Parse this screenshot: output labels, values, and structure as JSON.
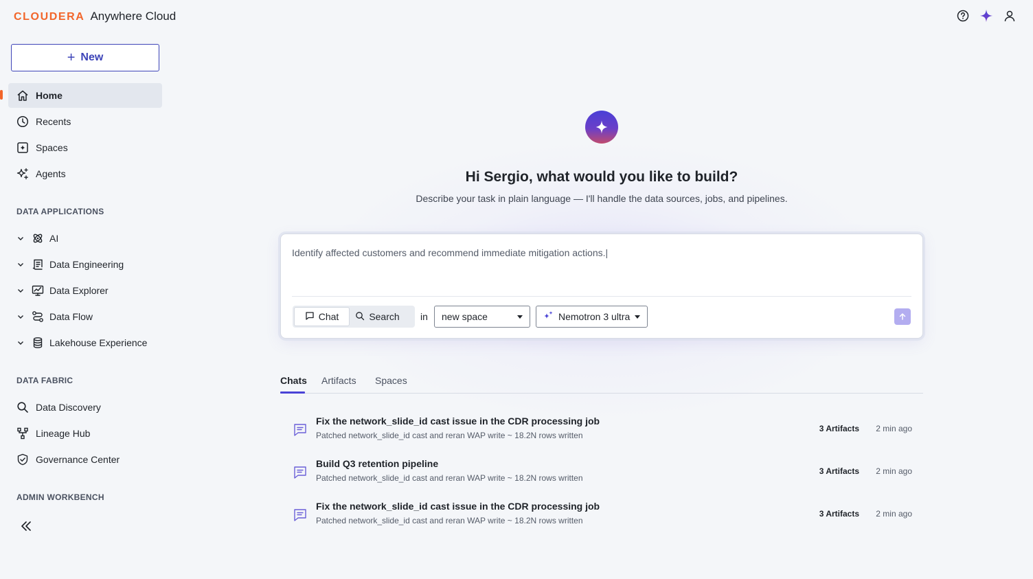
{
  "brand": {
    "logo": "CLOUDERA",
    "product": "Anywhere Cloud"
  },
  "colors": {
    "accent": "#3d44b8",
    "brand_orange": "#f2652a",
    "ai_purple": "#4a43d6"
  },
  "header": {
    "icons": [
      "help-icon",
      "ai-sparkle-icon",
      "user-icon"
    ]
  },
  "sidebar": {
    "new_label": "New",
    "nav": [
      {
        "label": "Home",
        "icon": "home-icon",
        "active": true
      },
      {
        "label": "Recents",
        "icon": "clock-icon"
      },
      {
        "label": "Spaces",
        "icon": "spaces-icon"
      },
      {
        "label": "Agents",
        "icon": "agents-sparkle-icon"
      }
    ],
    "data_applications_title": "DATA APPLICATIONS",
    "data_applications": [
      {
        "label": "AI",
        "icon": "ai-icon"
      },
      {
        "label": "Data Engineering",
        "icon": "data-engineering-icon"
      },
      {
        "label": "Data Explorer",
        "icon": "data-explorer-icon"
      },
      {
        "label": "Data Flow",
        "icon": "data-flow-icon"
      },
      {
        "label": "Lakehouse Experience",
        "icon": "database-icon"
      }
    ],
    "data_fabric_title": "DATA FABRIC",
    "data_fabric": [
      {
        "label": "Data Discovery",
        "icon": "search-icon"
      },
      {
        "label": "Lineage Hub",
        "icon": "lineage-icon"
      },
      {
        "label": "Governance Center",
        "icon": "shield-icon"
      }
    ],
    "admin_workbench_title": "ADMIN WORKBENCH"
  },
  "hero": {
    "title": "Hi Sergio, what would you like to build?",
    "subtitle": "Describe your task in plain language — I'll handle the data sources, jobs, and pipelines."
  },
  "prompt": {
    "text": "Identify affected customers and recommend immediate mitigation actions.|",
    "modes": [
      "Chat",
      "Search"
    ],
    "active_mode": "Chat",
    "in_label": "in",
    "space_value": "new space",
    "model_value": "Nemotron 3 ultra"
  },
  "tabs": [
    "Chats",
    "Artifacts",
    "Spaces"
  ],
  "active_tab": "Chats",
  "chats": [
    {
      "title": "Fix the network_slide_id cast issue in the CDR processing job",
      "desc": "Patched network_slide_id cast and reran WAP write ~ 18.2N rows written",
      "artifacts": "3 Artifacts",
      "time": "2 min ago"
    },
    {
      "title": "Build Q3 retention pipeline",
      "desc": "Patched network_slide_id cast and reran WAP write ~ 18.2N rows written",
      "artifacts": "3 Artifacts",
      "time": "2 min ago"
    },
    {
      "title": "Fix the network_slide_id cast issue in the CDR processing job",
      "desc": "Patched network_slide_id cast and reran WAP write ~ 18.2N rows written",
      "artifacts": "3 Artifacts",
      "time": "2 min ago"
    }
  ]
}
